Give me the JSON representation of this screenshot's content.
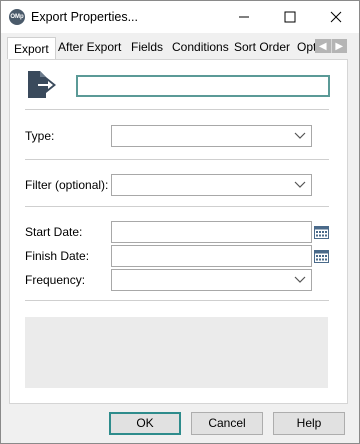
{
  "window": {
    "title": "Export Properties...",
    "app_icon_text": "OMp"
  },
  "tabs": [
    {
      "label": "Export",
      "active": true
    },
    {
      "label": "After Export",
      "active": false
    },
    {
      "label": "Fields",
      "active": false
    },
    {
      "label": "Conditions",
      "active": false
    },
    {
      "label": "Sort Order",
      "active": false
    },
    {
      "label": "Options",
      "active": false
    }
  ],
  "form": {
    "name_value": "",
    "type_label": "Type:",
    "type_value": "",
    "filter_label": "Filter (optional):",
    "filter_value": "",
    "start_date_label": "Start Date:",
    "start_date_value": "",
    "finish_date_label": "Finish Date:",
    "finish_date_value": "",
    "frequency_label": "Frequency:",
    "frequency_value": ""
  },
  "buttons": {
    "ok": "OK",
    "cancel": "Cancel",
    "help": "Help"
  },
  "icons": {
    "app": "app-logo-icon",
    "export": "export-arrow-icon",
    "calendar": "calendar-icon",
    "dropdown": "chevron-down-icon"
  },
  "colors": {
    "focus_border": "#5b9a97",
    "export_icon": "#3a4a5c",
    "default_button_border": "#2e8c8c"
  }
}
